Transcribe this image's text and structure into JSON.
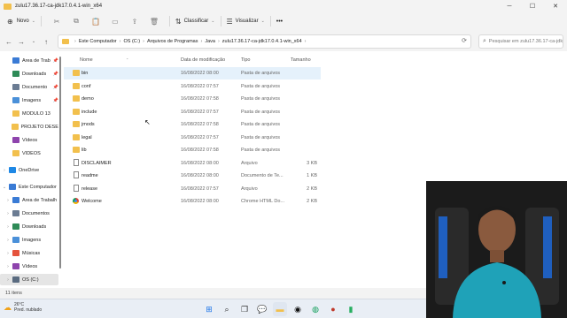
{
  "window": {
    "title": "zulu17.36.17-ca-jdk17.0.4.1-win_x64"
  },
  "toolbar": {
    "new_label": "Novo",
    "sort_label": "Classificar",
    "view_label": "Visualizar",
    "more_label": "•••"
  },
  "address": {
    "crumbs": [
      "Este Computador",
      "OS (C:)",
      "Arquivos de Programas",
      "Java",
      "zulu17.36.17-ca-jdk17.0.4.1-win_x64"
    ],
    "search_placeholder": "Pesquisar em zulu17.36.17-ca-jdk17.0.4.1-win_x64"
  },
  "columns": {
    "name": "Nome",
    "modified": "Data de modificação",
    "type": "Tipo",
    "size": "Tamanho"
  },
  "files": [
    {
      "name": "bin",
      "modified": "16/08/2022 08:00",
      "type": "Pasta de arquivos",
      "size": "",
      "kind": "folder"
    },
    {
      "name": "conf",
      "modified": "16/08/2022 07:57",
      "type": "Pasta de arquivos",
      "size": "",
      "kind": "folder"
    },
    {
      "name": "demo",
      "modified": "16/08/2022 07:58",
      "type": "Pasta de arquivos",
      "size": "",
      "kind": "folder"
    },
    {
      "name": "include",
      "modified": "16/08/2022 07:57",
      "type": "Pasta de arquivos",
      "size": "",
      "kind": "folder"
    },
    {
      "name": "jmods",
      "modified": "16/08/2022 07:58",
      "type": "Pasta de arquivos",
      "size": "",
      "kind": "folder"
    },
    {
      "name": "legal",
      "modified": "16/08/2022 07:57",
      "type": "Pasta de arquivos",
      "size": "",
      "kind": "folder"
    },
    {
      "name": "lib",
      "modified": "16/08/2022 07:58",
      "type": "Pasta de arquivos",
      "size": "",
      "kind": "folder"
    },
    {
      "name": "DISCLAIMER",
      "modified": "16/08/2022 08:00",
      "type": "Arquivo",
      "size": "3 KB",
      "kind": "doc"
    },
    {
      "name": "readme",
      "modified": "16/08/2022 08:00",
      "type": "Documento de Te...",
      "size": "1 KB",
      "kind": "doc"
    },
    {
      "name": "release",
      "modified": "16/08/2022 07:57",
      "type": "Arquivo",
      "size": "2 KB",
      "kind": "doc"
    },
    {
      "name": "Welcome",
      "modified": "16/08/2022 08:00",
      "type": "Chrome HTML Do...",
      "size": "2 KB",
      "kind": "chrome"
    }
  ],
  "sidebar": [
    {
      "label": "Área de Trab",
      "icon": "desktop-icon",
      "color": "#3a7bd5",
      "pinned": true
    },
    {
      "label": "Downloads",
      "icon": "download-icon",
      "color": "#2e8b57",
      "pinned": true
    },
    {
      "label": "Documento",
      "icon": "document-icon",
      "color": "#6b7c93",
      "pinned": true
    },
    {
      "label": "Imagens",
      "icon": "image-icon",
      "color": "#4a90d9",
      "pinned": true
    },
    {
      "label": "MÓDULO 13",
      "icon": "folder-icon",
      "color": "#f2c04d",
      "pinned": false
    },
    {
      "label": "PROJETO DESEN",
      "icon": "folder-icon",
      "color": "#f2c04d",
      "pinned": false
    },
    {
      "label": "Vídeos",
      "icon": "video-icon",
      "color": "#8e44ad",
      "pinned": false
    },
    {
      "label": "VÍDEOS",
      "icon": "folder-icon",
      "color": "#f2c04d",
      "pinned": false
    },
    {
      "label": "OneDrive",
      "icon": "cloud-icon",
      "color": "#1e88e5",
      "pinned": false
    },
    {
      "label": "Este Computador",
      "icon": "computer-icon",
      "color": "#3a7bd5",
      "pinned": false
    },
    {
      "label": "Área de Trabalh",
      "icon": "desktop-icon",
      "color": "#3a7bd5",
      "pinned": false
    },
    {
      "label": "Documentos",
      "icon": "document-icon",
      "color": "#6b7c93",
      "pinned": false
    },
    {
      "label": "Downloads",
      "icon": "download-icon",
      "color": "#2e8b57",
      "pinned": false
    },
    {
      "label": "Imagens",
      "icon": "image-icon",
      "color": "#4a90d9",
      "pinned": false
    },
    {
      "label": "Músicas",
      "icon": "music-icon",
      "color": "#e5533d",
      "pinned": false
    },
    {
      "label": "Vídeos",
      "icon": "video-icon",
      "color": "#8e44ad",
      "pinned": false
    },
    {
      "label": "OS (C:)",
      "icon": "drive-icon",
      "color": "#5a6b80",
      "pinned": false
    }
  ],
  "status": {
    "count": "11 itens"
  },
  "weather": {
    "temp": "26°C",
    "desc": "Pred. nublado"
  }
}
